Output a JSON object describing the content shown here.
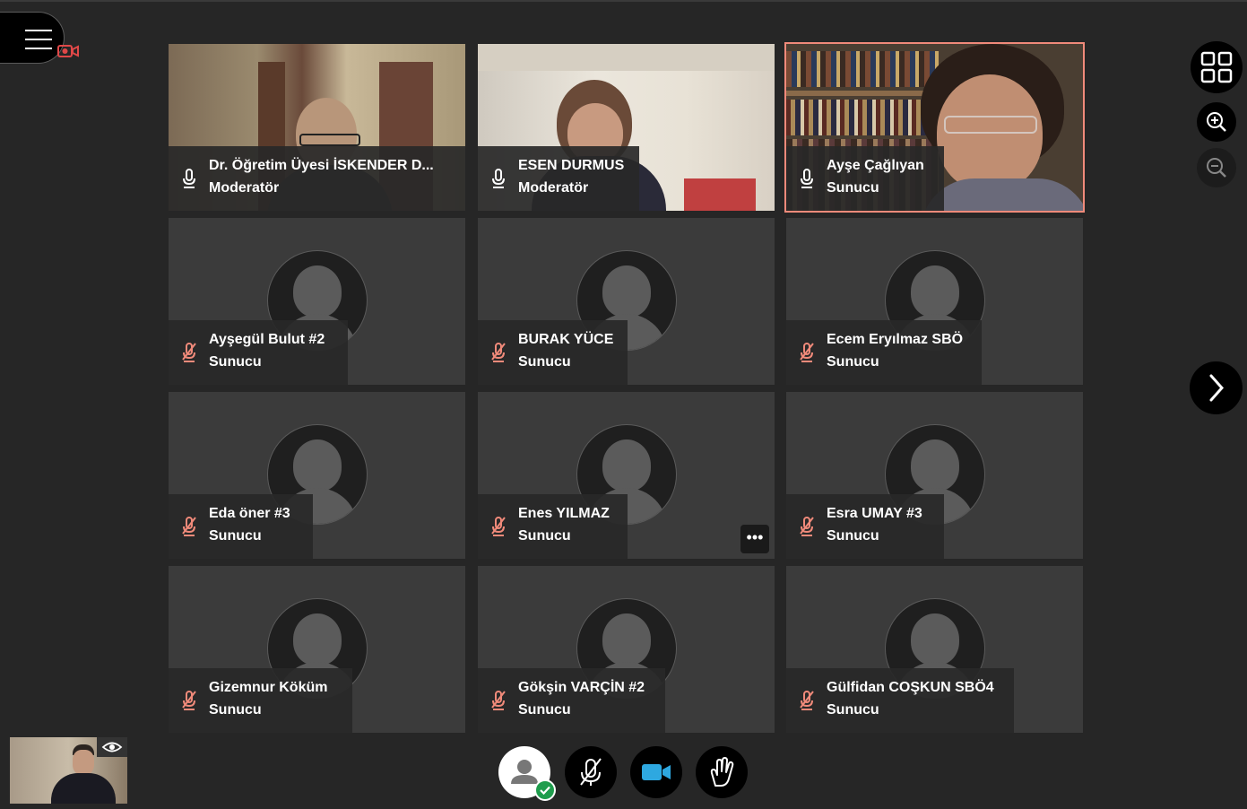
{
  "participants": [
    {
      "name": "Dr. Öğretim Üyesi İSKENDER D...",
      "role": "Moderatör",
      "mic": "on",
      "video": true,
      "active": false
    },
    {
      "name": "ESEN DURMUS",
      "role": "Moderatör",
      "mic": "on",
      "video": true,
      "active": false
    },
    {
      "name": "Ayşe Çağlıyan",
      "role": "Sunucu",
      "mic": "on",
      "video": true,
      "active": true
    },
    {
      "name": "Ayşegül Bulut #2",
      "role": "Sunucu",
      "mic": "muted",
      "video": false,
      "active": false
    },
    {
      "name": "BURAK YÜCE",
      "role": "Sunucu",
      "mic": "muted",
      "video": false,
      "active": false
    },
    {
      "name": "Ecem Eryılmaz SBÖ",
      "role": "Sunucu",
      "mic": "muted",
      "video": false,
      "active": false
    },
    {
      "name": "Eda öner #3",
      "role": "Sunucu",
      "mic": "muted",
      "video": false,
      "active": false
    },
    {
      "name": "Enes YILMAZ",
      "role": "Sunucu",
      "mic": "muted",
      "video": false,
      "active": false,
      "more_menu": "•••"
    },
    {
      "name": "Esra UMAY #3",
      "role": "Sunucu",
      "mic": "muted",
      "video": false,
      "active": false
    },
    {
      "name": "Gizemnur Köküm",
      "role": "Sunucu",
      "mic": "muted",
      "video": false,
      "active": false
    },
    {
      "name": "Gökşin VARÇİN #2",
      "role": "Sunucu",
      "mic": "muted",
      "video": false,
      "active": false
    },
    {
      "name": "Gülfidan COŞKUN SBÖ4",
      "role": "Sunucu",
      "mic": "muted",
      "video": false,
      "active": false
    }
  ],
  "colors": {
    "background": "#262626",
    "tile": "#3b3b3b",
    "muted_icon": "#f08a7a",
    "active_border": "#f08a7a",
    "status_ok": "#1f9d4d",
    "camera_on": "#2ea8e0"
  },
  "icons": {
    "menu": "hamburger-icon",
    "recording": "recording-camera-icon",
    "grid": "grid-layout-icon",
    "zoom_in": "zoom-in-icon",
    "zoom_out": "zoom-out-icon",
    "next": "chevron-right-icon",
    "self_view": "eye-icon",
    "status": "user-status-icon",
    "mic": "microphone-muted-icon",
    "camera": "camera-icon",
    "hand": "raise-hand-icon"
  }
}
